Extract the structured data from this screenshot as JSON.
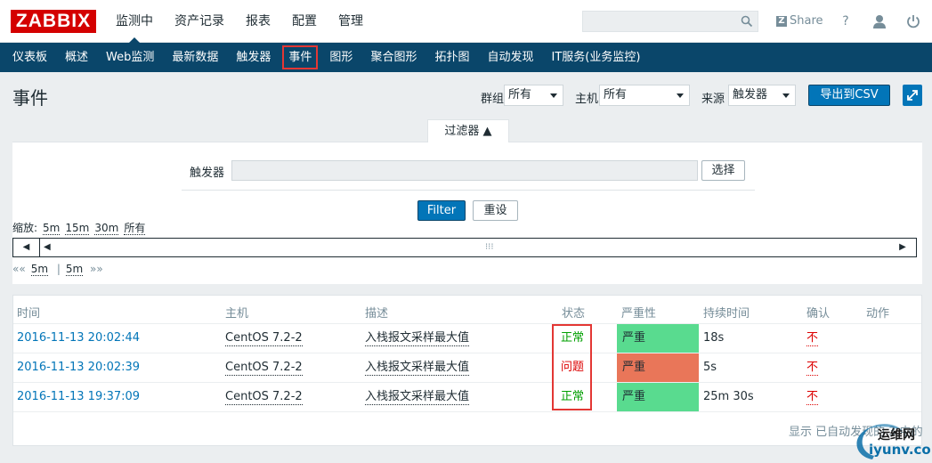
{
  "header": {
    "logo": "ZABBIX",
    "nav": [
      "监测中",
      "资产记录",
      "报表",
      "配置",
      "管理"
    ],
    "share": "Share",
    "help": "?"
  },
  "subnav": [
    "仪表板",
    "概述",
    "Web监测",
    "最新数据",
    "触发器",
    "事件",
    "图形",
    "聚合图形",
    "拓扑图",
    "自动发现",
    "IT服务(业务监控)"
  ],
  "page": {
    "title": "事件",
    "group_label": "群组",
    "group_value": "所有",
    "host_label": "主机",
    "host_value": "所有",
    "source_label": "来源",
    "source_value": "触发器",
    "export_label": "导出到CSV"
  },
  "filter": {
    "tab_label": "过滤器 ▲",
    "trigger_label": "触发器",
    "select_label": "选择",
    "filter_btn": "Filter",
    "reset_btn": "重设"
  },
  "zoom": {
    "label": "缩放:",
    "options": [
      "5m",
      "15m",
      "30m",
      "所有"
    ]
  },
  "paging": {
    "prev": "««",
    "left": "5m",
    "sep": "|",
    "right": "5m",
    "next": "»»"
  },
  "table": {
    "columns": [
      "时间",
      "主机",
      "描述",
      "状态",
      "严重性",
      "持续时间",
      "确认",
      "动作"
    ],
    "rows": [
      {
        "time": "2016-11-13 20:02:44",
        "host": "CentOS 7.2-2",
        "desc": "入栈报文采样最大值",
        "status": "正常",
        "severity": "严重",
        "duration": "18s",
        "ack": "不"
      },
      {
        "time": "2016-11-13 20:02:39",
        "host": "CentOS 7.2-2",
        "desc": "入栈报文采样最大值",
        "status": "问题",
        "severity": "严重",
        "duration": "5s",
        "ack": "不"
      },
      {
        "time": "2016-11-13 19:37:09",
        "host": "CentOS 7.2-2",
        "desc": "入栈报文采样最大值",
        "status": "正常",
        "severity": "严重",
        "duration": "25m 30s",
        "ack": "不"
      }
    ],
    "footer": "显示 已自动发现的 3 中的"
  },
  "watermark": {
    "top": "运维网",
    "bottom": "iyunv.com"
  },
  "colors": {
    "severity_ok_bg": "#59db8f",
    "severity_problem_bg": "#e97659",
    "nav_bg": "#0a466a",
    "logo_bg": "#d40000"
  }
}
